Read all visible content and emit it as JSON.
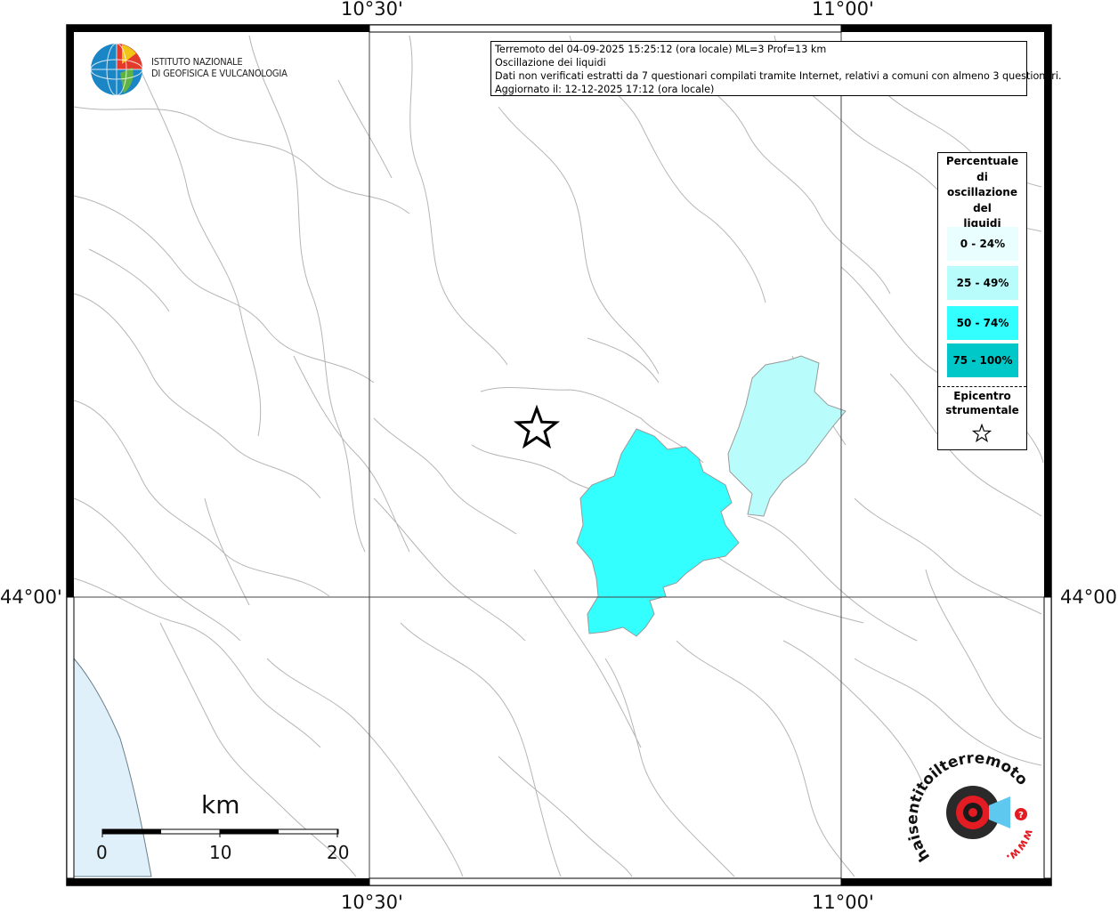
{
  "header": {
    "lines": [
      "Terremoto del 04-09-2025 15:25:12 (ora locale) ML=3 Prof=13 km",
      "Oscillazione dei liquidi",
      "Dati non verificati estratti da 7 questionari compilati tramite Internet, relativi a comuni con almeno 3 questionari.",
      "Aggiornato il: 12-12-2025 17:12 (ora locale)"
    ]
  },
  "coordinates": {
    "top_left": "10°30'",
    "top_right": "11°00'",
    "bottom_left": "10°30'",
    "bottom_right": "11°00'",
    "left_lat": "44°00'",
    "right_lat": "44°00'"
  },
  "logo": {
    "line1": "ISTITUTO NAZIONALE",
    "line2": "DI GEOFISICA E VULCANOLOGIA"
  },
  "legend": {
    "title": [
      "Percentuale",
      "di",
      "oscillazione",
      "del",
      "liquidi"
    ],
    "classes": [
      {
        "label": "0 - 24%",
        "color": "#e9fefe"
      },
      {
        "label": "25 - 49%",
        "color": "#b8fcfc"
      },
      {
        "label": "50 - 74%",
        "color": "#33ffff"
      },
      {
        "label": "75 - 100%",
        "color": "#00c8c8"
      }
    ],
    "epicenter_title": [
      "Epicentro",
      "strumentale"
    ],
    "epicenter_icon": "star-outline-icon"
  },
  "scale": {
    "unit": "km",
    "ticks": [
      "0",
      "10",
      "20"
    ]
  },
  "watermark": {
    "text": "haisentitoilterremoto.it",
    "prefix": "www."
  },
  "colors": {
    "sea": "#dff0fb",
    "boundary": "#b5b5b5",
    "frame": "#000000"
  }
}
